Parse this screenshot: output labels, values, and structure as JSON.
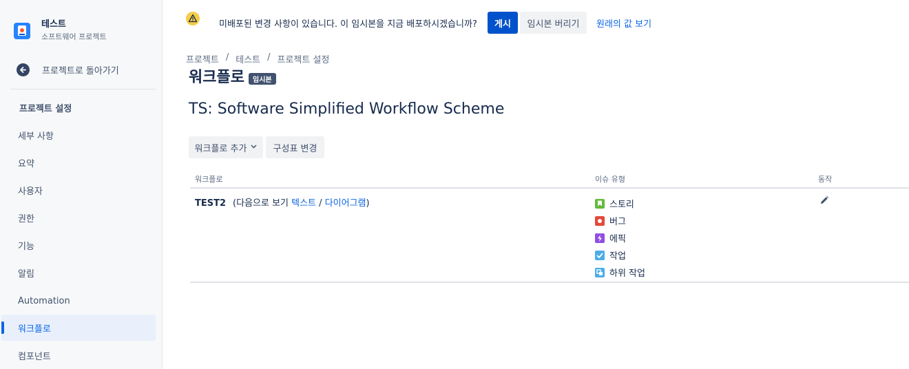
{
  "sidebar": {
    "project_name": "테스트",
    "project_type": "소프트웨어 프로젝트",
    "back_label": "프로젝트로 돌아가기",
    "section_title": "프로젝트 설정",
    "items": [
      {
        "label": "세부 사항"
      },
      {
        "label": "요약"
      },
      {
        "label": "사용자"
      },
      {
        "label": "권한"
      },
      {
        "label": "기능"
      },
      {
        "label": "알림"
      },
      {
        "label": "Automation"
      },
      {
        "label": "워크플로",
        "active": true
      },
      {
        "label": "컴포넌트"
      }
    ]
  },
  "banner": {
    "message": "미배포된 변경 사항이 있습니다. 이 임시본을 지금 배포하시겠습니까?",
    "publish_label": "게시",
    "discard_label": "임시본 버리기",
    "view_original_label": "원래의 값 보기"
  },
  "breadcrumb": [
    "프로젝트",
    "테스트",
    "프로젝트 설정"
  ],
  "page": {
    "title": "워크플로",
    "badge": "임시본",
    "scheme_title": "TS: Software Simplified Workflow Scheme",
    "add_workflow_label": "워크플로 추가",
    "change_scheme_label": "구성표 변경"
  },
  "table": {
    "headers": {
      "workflow": "워크플로",
      "issue_types": "이슈 유형",
      "actions": "동작"
    },
    "rows": [
      {
        "name": "TEST2",
        "view_prefix": "(다음으로 보기 ",
        "text_link": "텍스트",
        "slash": " / ",
        "diagram_link": "다이어그램",
        "view_suffix": ")",
        "issue_types": [
          {
            "label": "스토리",
            "icon": "story-icon",
            "color": "#63ba3c"
          },
          {
            "label": "버그",
            "icon": "bug-icon",
            "color": "#e5493a"
          },
          {
            "label": "에픽",
            "icon": "epic-icon",
            "color": "#904ee2"
          },
          {
            "label": "작업",
            "icon": "task-icon",
            "color": "#4bade8"
          },
          {
            "label": "하위 작업",
            "icon": "subtask-icon",
            "color": "#4bade8"
          }
        ]
      }
    ]
  },
  "colors": {
    "primary": "#0052cc",
    "link": "#0c66e4",
    "active_nav_bg": "#e9f0fc",
    "warning": "#f5cd47"
  }
}
